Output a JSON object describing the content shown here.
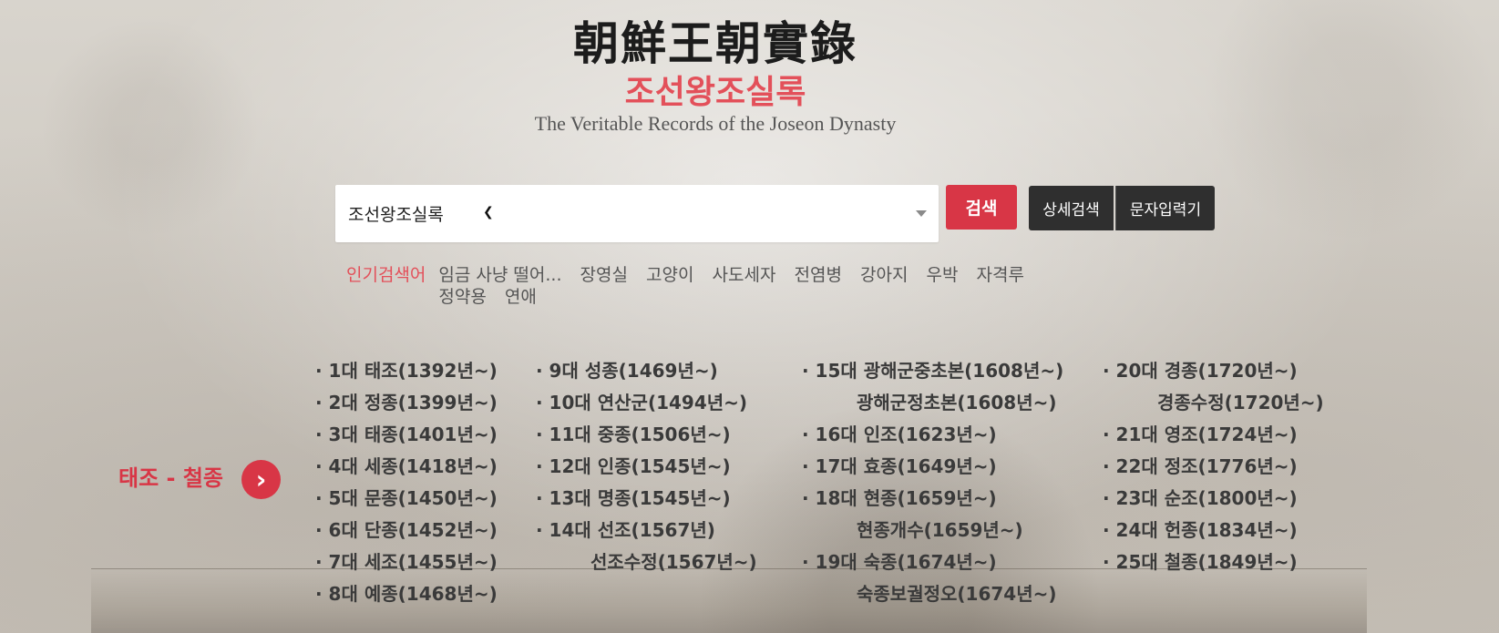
{
  "header": {
    "title_cn": "朝鮮王朝實錄",
    "title_ko": "조선왕조실록",
    "title_en": "The Veritable Records of the Joseon Dynasty"
  },
  "search": {
    "select_value": "조선왕조실록",
    "search_button": "검색",
    "advanced_button": "상세검색",
    "char_input_button": "문자입력기"
  },
  "popular": {
    "label": "인기검색어",
    "terms": [
      "임금 사냥 떨어...",
      "장영실",
      "고양이",
      "사도세자",
      "전염병",
      "강아지",
      "우박",
      "자격루",
      "정약용",
      "연애"
    ]
  },
  "era": {
    "label": "태조 - 철종",
    "arrow_icon": "chevron-right-icon"
  },
  "kings": {
    "col1": [
      "· 1대 태조(1392년~)",
      "· 2대 정종(1399년~)",
      "· 3대 태종(1401년~)",
      "· 4대 세종(1418년~)",
      "· 5대 문종(1450년~)",
      "· 6대 단종(1452년~)",
      "· 7대 세조(1455년~)",
      "· 8대 예종(1468년~)"
    ],
    "col2": [
      "· 9대 성종(1469년~)",
      "· 10대 연산군(1494년~)",
      "· 11대 중종(1506년~)",
      "· 12대 인종(1545년~)",
      "· 13대 명종(1545년~)",
      "· 14대 선조(1567년)",
      "선조수정(1567년~)"
    ],
    "col3": [
      "· 15대 광해군중초본(1608년~)",
      "광해군정초본(1608년~)",
      "· 16대 인조(1623년~)",
      "· 17대 효종(1649년~)",
      "· 18대 현종(1659년~)",
      "현종개수(1659년~)",
      "· 19대 숙종(1674년~)",
      "숙종보궐정오(1674년~)"
    ],
    "col4": [
      "· 20대 경종(1720년~)",
      "경종수정(1720년~)",
      "· 21대 영조(1724년~)",
      "· 22대 정조(1776년~)",
      "· 23대 순조(1800년~)",
      "· 24대 헌종(1834년~)",
      "· 25대 철종(1849년~)"
    ]
  },
  "colors": {
    "accent": "#d83646",
    "dark_button": "#2f2f2f"
  }
}
